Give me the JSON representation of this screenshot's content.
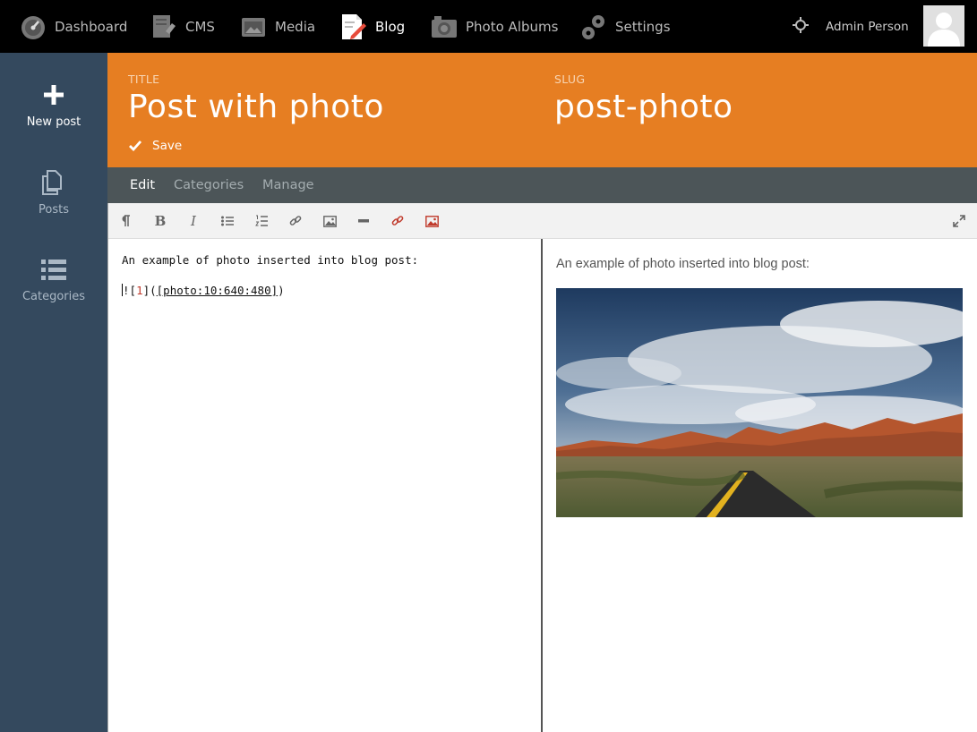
{
  "nav": {
    "items": [
      {
        "label": "Dashboard",
        "icon": "speedometer-icon"
      },
      {
        "label": "CMS",
        "icon": "cms-icon"
      },
      {
        "label": "Media",
        "icon": "media-icon"
      },
      {
        "label": "Blog",
        "icon": "blog-icon"
      },
      {
        "label": "Photo Albums",
        "icon": "camera-icon"
      },
      {
        "label": "Settings",
        "icon": "gears-icon"
      }
    ],
    "active": "Blog",
    "user_name": "Admin Person"
  },
  "sidebar": {
    "items": [
      {
        "label": "New post",
        "icon": "plus-icon"
      },
      {
        "label": "Posts",
        "icon": "copy-icon"
      },
      {
        "label": "Categories",
        "icon": "list-icon"
      }
    ]
  },
  "header": {
    "title_caption": "TITLE",
    "title_value": "Post with photo",
    "slug_caption": "SLUG",
    "slug_value": "post-photo",
    "save_label": "Save",
    "accent_color": "#e67e22"
  },
  "tabs": [
    {
      "label": "Edit",
      "active": true
    },
    {
      "label": "Categories",
      "active": false
    },
    {
      "label": "Manage",
      "active": false
    }
  ],
  "editor": {
    "line1": "An example of photo inserted into blog post:",
    "line2_prefix": "!",
    "line2_open": "[",
    "line2_num": "1",
    "line2_mid": "](",
    "line2_url": "[photo:10:640:480]",
    "line2_close": ")"
  },
  "preview": {
    "text": "An example of photo inserted into blog post:"
  },
  "toolbar": {
    "buttons": [
      "paragraph-icon",
      "bold-icon",
      "italic-icon",
      "bullet-list-icon",
      "numbered-list-icon",
      "link-icon",
      "image-icon",
      "horizontal-rule-icon",
      "custom-link-icon",
      "custom-image-icon",
      "fullscreen-icon"
    ]
  }
}
